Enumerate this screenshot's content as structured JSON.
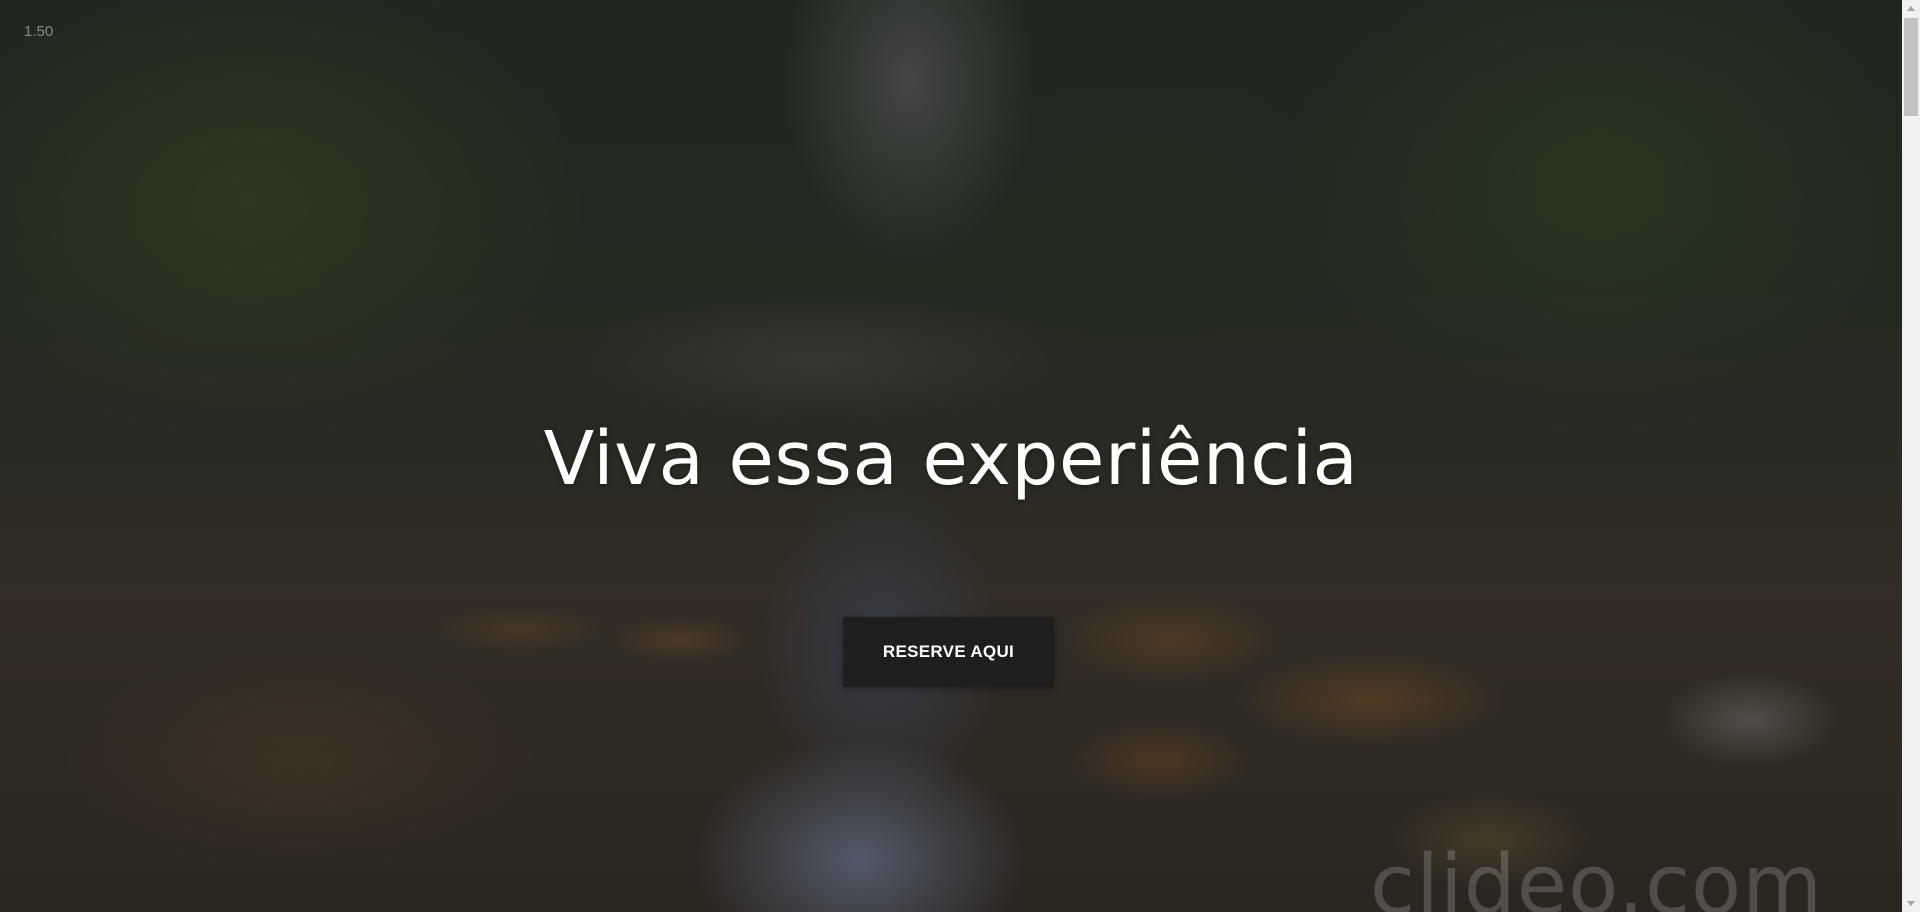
{
  "video": {
    "speed_label": "1.50",
    "watermark": "clideo.com"
  },
  "hero": {
    "title": "Viva essa experiência",
    "cta_label": "RESERVE AQUI"
  },
  "colors": {
    "button_bg": "#1e1e1e",
    "title_text": "#ffffff"
  }
}
